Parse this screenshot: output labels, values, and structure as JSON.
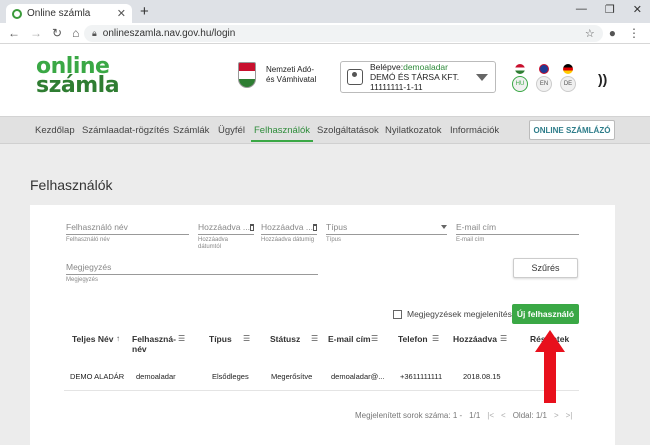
{
  "browser": {
    "tab_title": "Online számla",
    "url": "onlineszamla.nav.gov.hu/login"
  },
  "site": {
    "logo_top": "online",
    "logo_bottom": "számla",
    "agency_line1": "Nemzeti Adó-",
    "agency_line2": "és Vámhivatal",
    "user_label": "Belépve:",
    "user_name": "demoaladar",
    "company": "DEMÓ ÉS TÁRSA KFT.",
    "tax_number": "11111111-1-11",
    "languages": [
      "HU",
      "EN",
      "DE"
    ],
    "active_language": "HU"
  },
  "menu": {
    "items": [
      "Kezdőlap",
      "Számlaadat-rögzítés",
      "Számlák",
      "Ügyfél",
      "Felhasználók",
      "Szolgáltatások",
      "Nyilatkozatok",
      "Információk"
    ],
    "active": "Felhasználók",
    "invoicer_button": "ONLINE SZÁMLÁZÓ"
  },
  "page": {
    "title": "Felhasználók",
    "filters": {
      "username_placeholder": "Felhasználó név",
      "username_hint": "Felhasználó név",
      "added_from_placeholder": "Hozzáadva ...",
      "added_from_hint1": "Hozzáadva",
      "added_from_hint2": "dátumtól",
      "added_to_placeholder": "Hozzáadva ...",
      "added_to_hint": "Hozzáadva dátumig",
      "type_placeholder": "Típus",
      "type_hint": "Típus",
      "email_placeholder": "E-mail cím",
      "email_hint": "E-mail cím",
      "note_placeholder": "Megjegyzés",
      "note_hint": "Megjegyzés",
      "filter_button": "Szűrés"
    },
    "show_notes_label": "Megjegyzések megjelenítése",
    "new_user_button": "Új felhasználó",
    "table": {
      "headers": [
        "Teljes Név",
        "Felhaszná-\nnév",
        "Típus",
        "Státusz",
        "E-mail cím",
        "Telefon",
        "Hozzáadva",
        "Részletek"
      ],
      "rows": [
        [
          "DEMO ALADÁR",
          "demoaladar",
          "Elsődleges",
          "Megerősítve",
          "demoaladar@...",
          "+3611111111",
          "2018.08.15",
          ""
        ]
      ]
    },
    "pager": {
      "label": "Megjelenített sorok száma: 1 -",
      "range": "1/1",
      "page_label": "Oldal: 1/1"
    }
  },
  "colors": {
    "brand_green": "#3aa845",
    "arrow_red": "#e8101c"
  }
}
